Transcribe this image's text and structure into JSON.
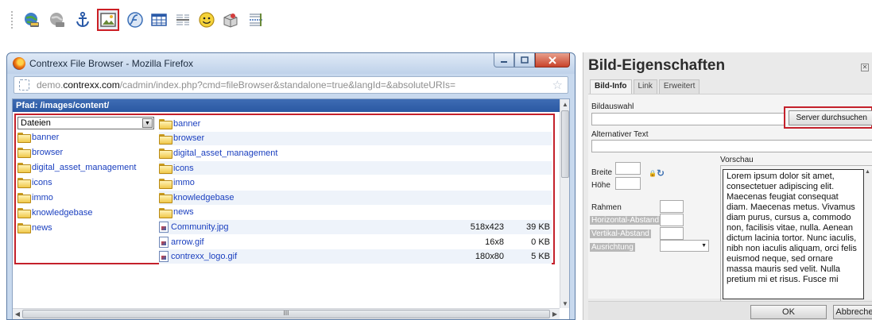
{
  "toolbar": {
    "icons": [
      "globe-icon",
      "grayscale-globe-icon",
      "anchor-icon",
      "image-icon",
      "flash-icon",
      "table-icon",
      "horizontal-rule-icon",
      "smiley-icon",
      "special-char-icon",
      "page-break-icon"
    ],
    "active_icon": "image-icon"
  },
  "browser_window": {
    "title": "Contrexx File Browser - Mozilla Firefox",
    "url_prefix": "demo.",
    "url_domain": "contrexx.com",
    "url_suffix": "/cadmin/index.php?cmd=fileBrowser&standalone=true&langId=&absoluteURIs=",
    "path_label": "Pfad: /images/content/",
    "type_select": "Dateien",
    "left_folders": [
      "banner",
      "browser",
      "digital_asset_management",
      "icons",
      "immo",
      "knowledgebase",
      "news"
    ],
    "right_folders": [
      "banner",
      "browser",
      "digital_asset_management",
      "icons",
      "immo",
      "knowledgebase",
      "news"
    ],
    "files": [
      {
        "name": "Community.jpg",
        "dimensions": "518x423",
        "size": "39 KB"
      },
      {
        "name": "arrow.gif",
        "dimensions": "16x8",
        "size": "0 KB"
      },
      {
        "name": "contrexx_logo.gif",
        "dimensions": "180x80",
        "size": "5 KB"
      }
    ],
    "hscroll_grip": "III"
  },
  "dialog": {
    "title": "Bild-Eigenschaften",
    "tabs": [
      "Bild-Info",
      "Link",
      "Erweitert"
    ],
    "image_select_label": "Bildauswahl",
    "server_button": "Server durchsuchen",
    "alt_text_label": "Alternativer Text",
    "width_label": "Breite",
    "height_label": "Höhe",
    "border_label": "Rahmen",
    "hspace_label": "Horizontal-Abstand",
    "vspace_label": "Vertikal-Abstand",
    "align_label": "Ausrichtung",
    "preview_label": "Vorschau",
    "preview_text": "Lorem ipsum dolor sit amet, consectetuer adipiscing elit. Maecenas feugiat consequat diam. Maecenas metus. Vivamus diam purus, cursus a, commodo non, facilisis vitae, nulla. Aenean dictum lacinia tortor. Nunc iaculis, nibh non iaculis aliquam, orci felis euismod neque, sed ornare massa mauris sed velit. Nulla pretium mi et risus. Fusce mi",
    "ok_button": "OK",
    "cancel_button": "Abbrechen"
  },
  "colors": {
    "highlight": "#c4212b",
    "path_bar": "#2f5ea8",
    "link": "#1a3fbf"
  }
}
